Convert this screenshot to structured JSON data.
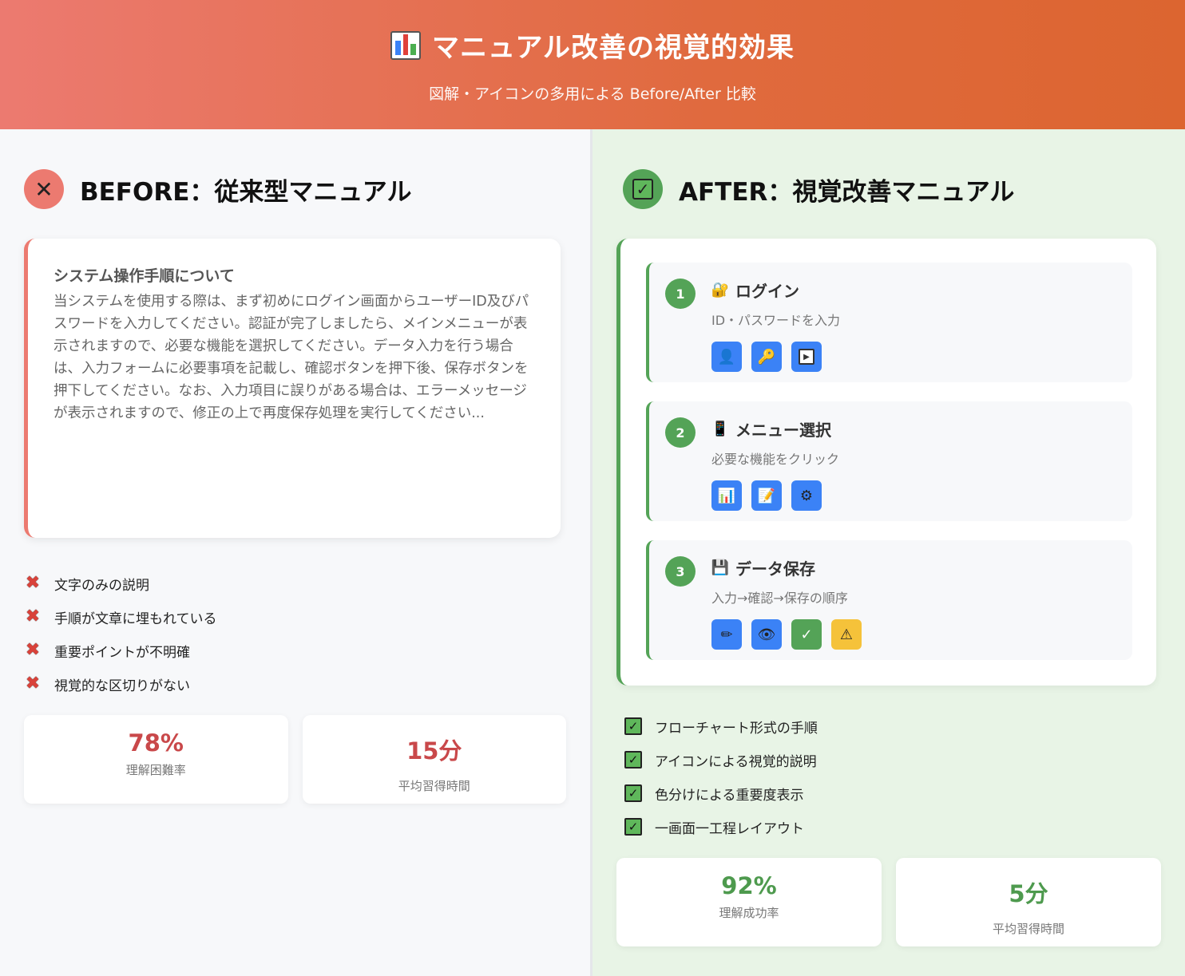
{
  "header": {
    "title": "マニュアル改善の視覚的効果",
    "subtitle": "図解・アイコンの多用による Before/After 比較",
    "icon": "bar-chart-icon"
  },
  "before": {
    "title": "BEFORE：従来型マニュアル",
    "badge_icon": "cross-icon",
    "card": {
      "heading": "システム操作手順について",
      "body": "当システムを使用する際は、まず初めにログイン画面からユーザーID及びパスワードを入力してください。認証が完了しましたら、メインメニューが表示されますので、必要な機能を選択してください。データ入力を行う場合は、入力フォームに必要事項を記載し、確認ボタンを押下後、保存ボタンを押下してください。なお、入力項目に誤りがある場合は、エラーメッセージが表示されますので、修正の上で再度保存処理を実行してください..."
    },
    "points": [
      "文字のみの説明",
      "手順が文章に埋もれている",
      "重要ポイントが不明確",
      "視覚的な区切りがない"
    ],
    "stats": [
      {
        "value": "78%",
        "label": "理解困難率"
      },
      {
        "value": "15分",
        "label": "平均習得時間"
      }
    ],
    "accent": "#ec7a70"
  },
  "after": {
    "title": "AFTER：視覚改善マニュアル",
    "badge_icon": "check-icon",
    "steps": [
      {
        "num": "1",
        "title": "ログイン",
        "desc": "ID・パスワードを入力",
        "icon": "lock-key-icon",
        "icons": [
          "user-icon",
          "key-icon",
          "play-icon"
        ]
      },
      {
        "num": "2",
        "title": "メニュー選択",
        "desc": "必要な機能をクリック",
        "icon": "phone-icon",
        "icons": [
          "chart-icon",
          "memo-icon",
          "gear-icon"
        ]
      },
      {
        "num": "3",
        "title": "データ保存",
        "desc": "入力→確認→保存の順序",
        "icon": "floppy-icon",
        "icons": [
          "pencil-icon",
          "eye-icon",
          "check-icon",
          "warning-icon"
        ]
      }
    ],
    "points": [
      "フローチャート形式の手順",
      "アイコンによる視覚的説明",
      "色分けによる重要度表示",
      "一画面一工程レイアウト"
    ],
    "stats": [
      {
        "value": "92%",
        "label": "理解成功率"
      },
      {
        "value": "5分",
        "label": "平均習得時間"
      }
    ],
    "accent": "#54a357"
  }
}
